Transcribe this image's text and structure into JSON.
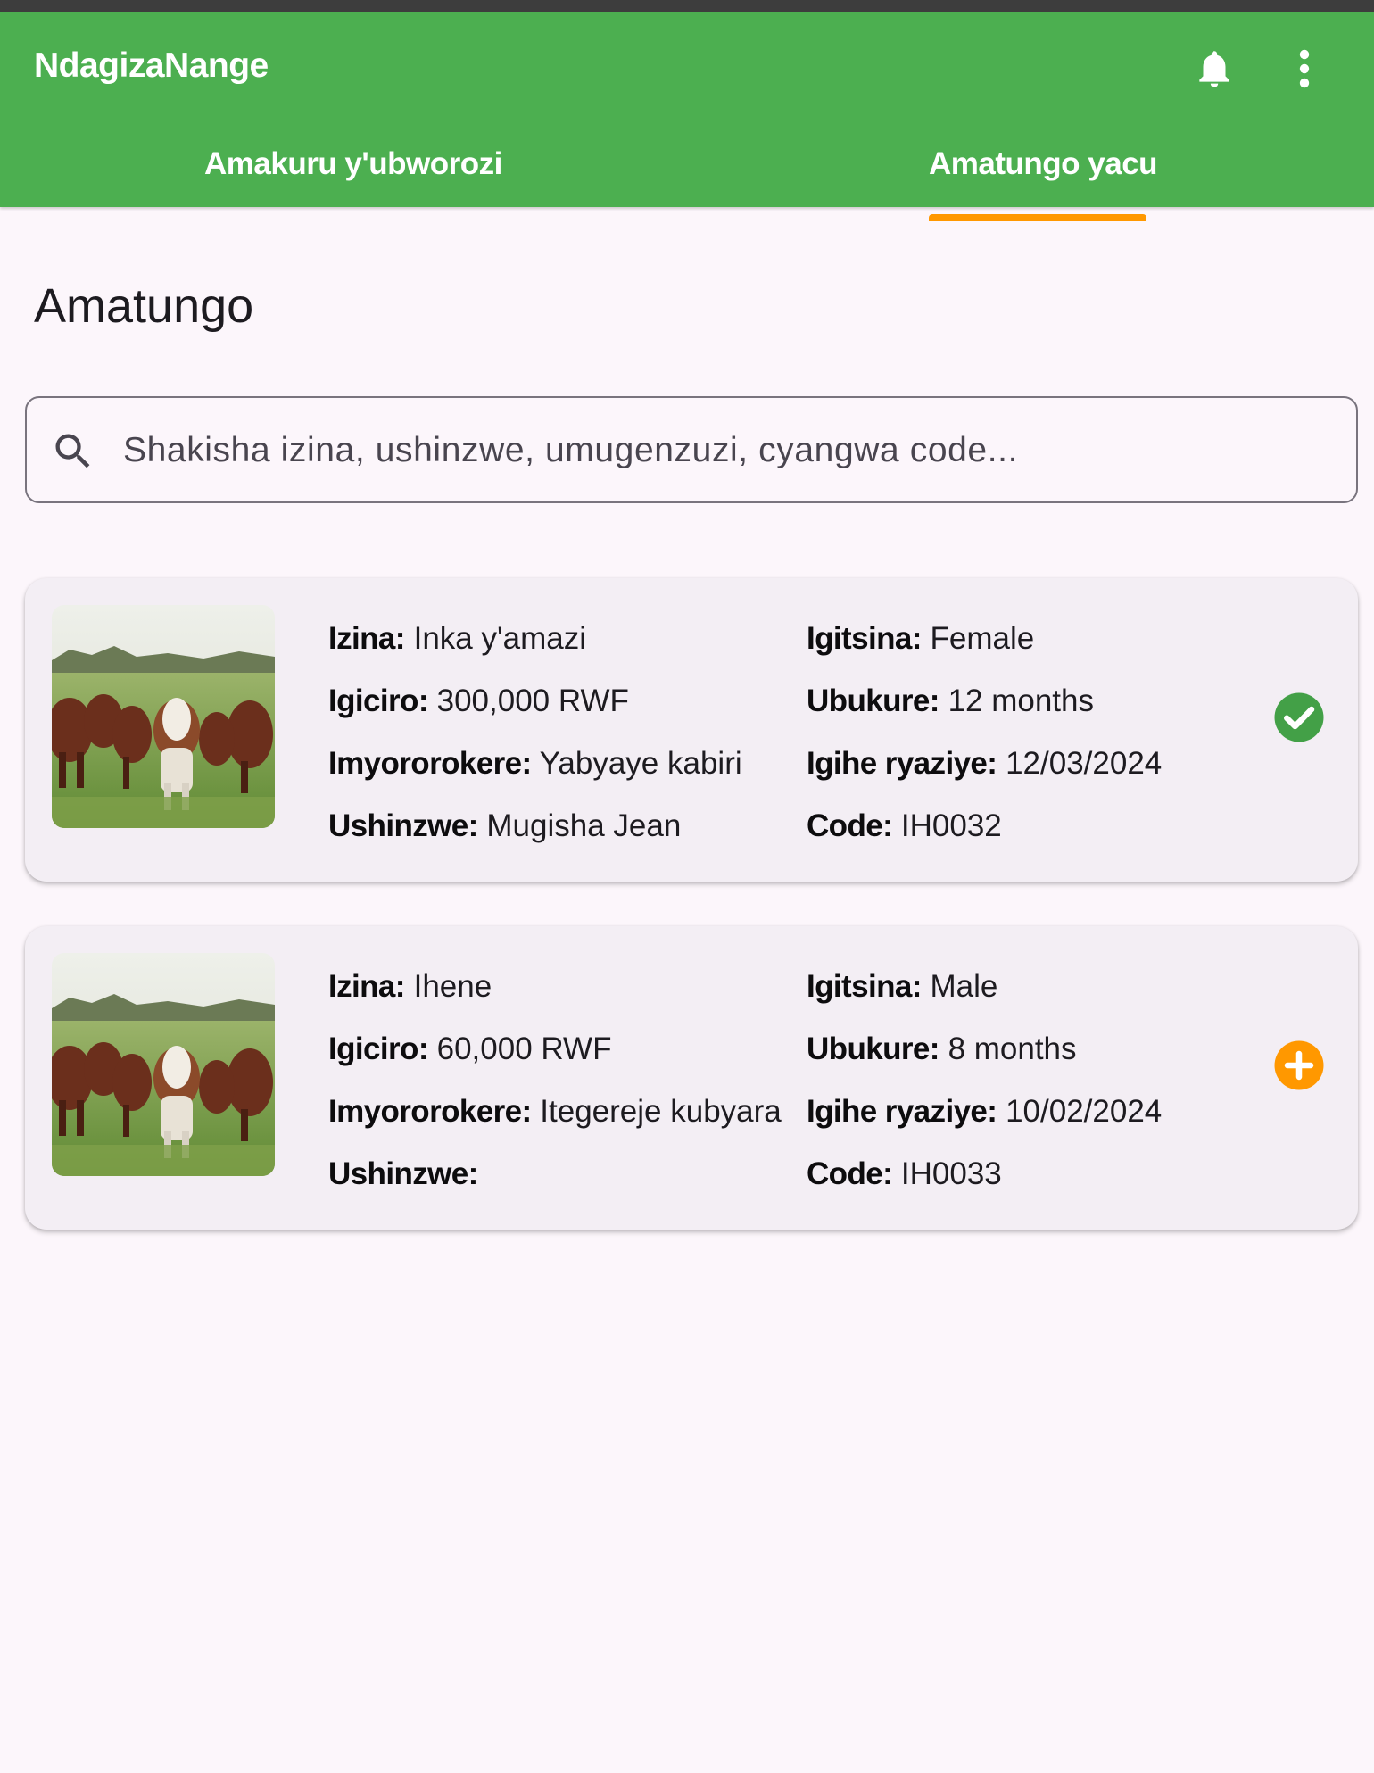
{
  "app": {
    "title": "NdagizaNange"
  },
  "tabs": [
    {
      "label": "Amakuru y'ubworozi",
      "active": false
    },
    {
      "label": "Amatungo yacu",
      "active": true
    }
  ],
  "page": {
    "title": "Amatungo"
  },
  "search": {
    "placeholder": "Shakisha izina, ushinzwe, umugenzuzi, cyangwa code...",
    "value": ""
  },
  "labels": {
    "name": "Izina:",
    "price": "Igiciro:",
    "breed": "Imyororokere:",
    "owner": "Ushinzwe:",
    "sex": "Igitsina:",
    "age": "Ubukure:",
    "arrival": "Igihe ryaziye:",
    "code": "Code:"
  },
  "animals": [
    {
      "name": "Inka y'amazi",
      "price": "300,000 RWF",
      "breed": "Yabyaye kabiri",
      "owner": "Mugisha Jean",
      "sex": "Female",
      "age": "12 months",
      "arrival": "12/03/2024",
      "code": "IH0032",
      "status_icon": "check-circle-icon",
      "status_color": "#43a047"
    },
    {
      "name": "Ihene",
      "price": "60,000 RWF",
      "breed": "Itegereje kubyara",
      "owner": "",
      "sex": "Male",
      "age": "8 months",
      "arrival": "10/02/2024",
      "code": "IH0033",
      "status_icon": "add-circle-icon",
      "status_color": "#ff9800"
    }
  ],
  "colors": {
    "app_bar": "#4caf50",
    "tab_indicator": "#ff9800",
    "background": "#fcf6fb",
    "card": "#f3eef4"
  }
}
